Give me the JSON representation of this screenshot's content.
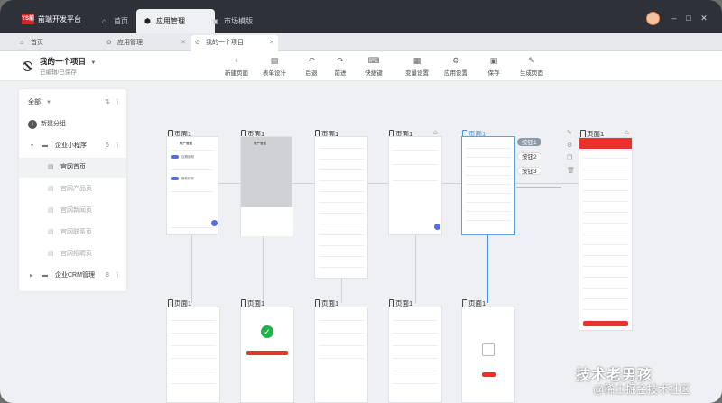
{
  "app": {
    "logo_text": "YS前",
    "title": "前端开发平台"
  },
  "title_tabs": [
    {
      "label": "首页",
      "icon": "home-icon"
    },
    {
      "label": "应用管理",
      "icon": "app-icon"
    },
    {
      "label": "市场模版",
      "icon": "market-icon"
    }
  ],
  "window": {
    "minimize": "–",
    "maximize": "□",
    "close": "✕"
  },
  "sub_tabs": [
    {
      "label": "首页"
    },
    {
      "label": "应用管理"
    },
    {
      "label": "我的一个项目"
    }
  ],
  "project": {
    "name": "我的一个项目",
    "status": "已编辑/已保存"
  },
  "toolbar": [
    {
      "icon": "plus-icon",
      "glyph": "+",
      "label": "新建页面"
    },
    {
      "icon": "form-icon",
      "glyph": "▤",
      "label": "表单设计"
    },
    {
      "icon": "undo-icon",
      "glyph": "↶",
      "label": "后退"
    },
    {
      "icon": "redo-icon",
      "glyph": "↷",
      "label": "前进"
    },
    {
      "icon": "keyboard-icon",
      "glyph": "⌨",
      "label": "快捷键"
    },
    {
      "icon": "variable-icon",
      "glyph": "▦",
      "label": "变量设置"
    },
    {
      "icon": "settings-icon",
      "glyph": "⚙",
      "label": "应用设置"
    },
    {
      "icon": "save-icon",
      "glyph": "▣",
      "label": "保存"
    },
    {
      "icon": "generate-icon",
      "glyph": "✎",
      "label": "生成页面"
    }
  ],
  "sidebar": {
    "filter": "全部",
    "new_group": "新建分组",
    "groups": [
      {
        "name": "企业小程序",
        "count": "6"
      },
      {
        "name": "企业CRM管理",
        "count": "8"
      }
    ],
    "pages": [
      "官网首页",
      "官网产品页",
      "官网新闻页",
      "官网联系页",
      "官网招聘页"
    ]
  },
  "canvas": {
    "page_label": "页面1",
    "buttons": [
      "按钮1",
      "按钮2",
      "按钮3"
    ],
    "preview": {
      "nav_title": "资产管理",
      "sec1": "近期通知",
      "sec2": "最新任务"
    }
  },
  "watermark": {
    "line1": "技术老男孩",
    "line2": "@稀土掘金技术社区"
  }
}
